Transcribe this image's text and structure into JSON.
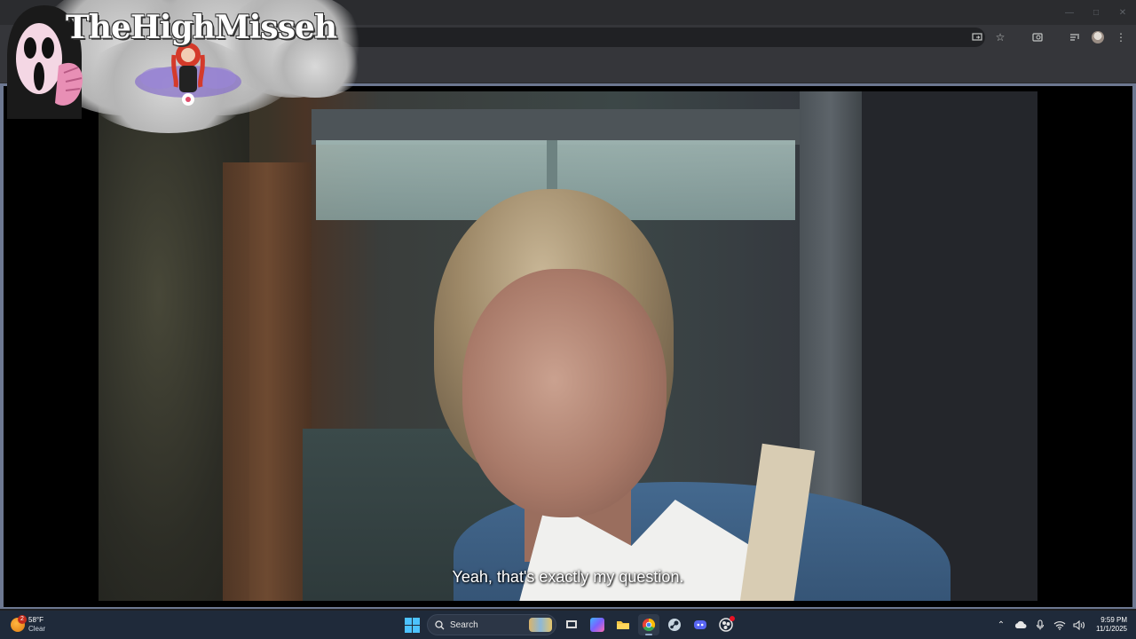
{
  "overlay": {
    "brand_text": "TheHighMisseh"
  },
  "video": {
    "subtitle": "Yeah, that's exactly my question."
  },
  "taskbar": {
    "weather": {
      "temp": "58°F",
      "condition": "Clear",
      "badge": "2"
    },
    "search_label": "Search",
    "apps": [
      {
        "name": "task-view",
        "color": "#dcdcdc"
      },
      {
        "name": "copilot",
        "color": "#7b61ff"
      },
      {
        "name": "file-explorer",
        "color": "#f4c542"
      },
      {
        "name": "chrome",
        "color": "#34a853"
      },
      {
        "name": "steam",
        "color": "#1b2838"
      },
      {
        "name": "discord",
        "color": "#5865f2"
      },
      {
        "name": "obs",
        "color": "#e6e6e6"
      }
    ],
    "clock": {
      "time": "9:59 PM",
      "date": "11/1/2025"
    }
  },
  "colors": {
    "accent": "#4cc2ff",
    "taskbar": "#1f2a3a",
    "chrome": "#35363a"
  }
}
